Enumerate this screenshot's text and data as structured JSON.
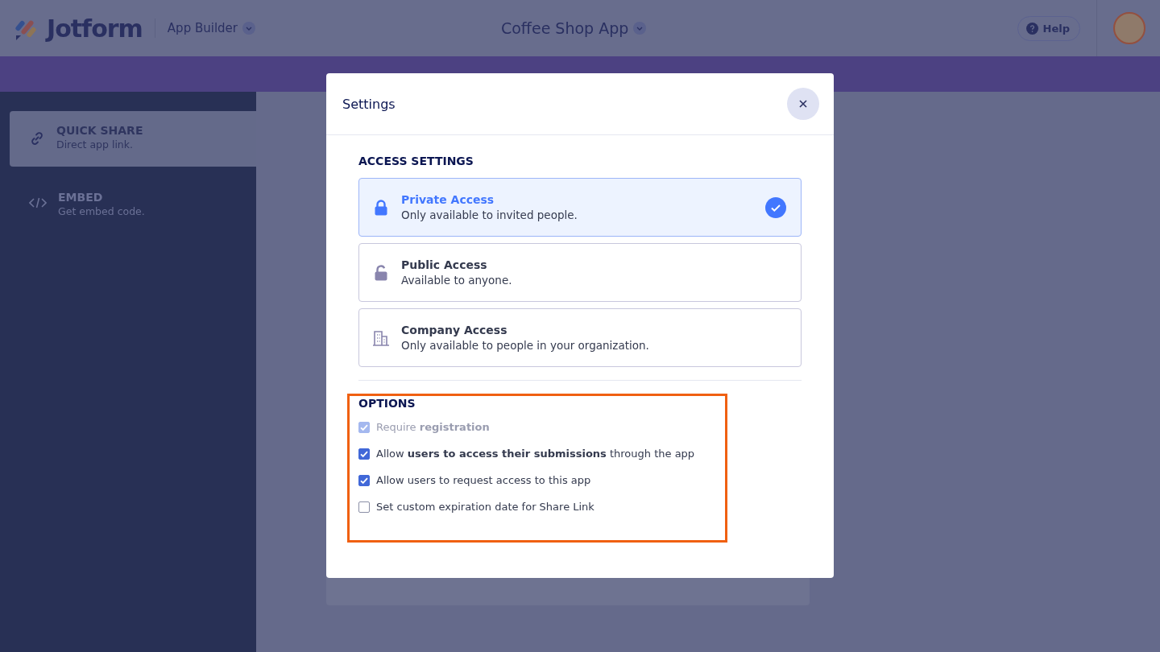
{
  "header": {
    "brand": "Jotform",
    "product": "App Builder",
    "app_title": "Coffee Shop App",
    "help": "Help"
  },
  "sidebar": {
    "items": [
      {
        "title": "QUICK SHARE",
        "subtitle": "Direct app link.",
        "selected": true,
        "kind": "link"
      },
      {
        "title": "EMBED",
        "subtitle": "Get embed code.",
        "selected": false,
        "kind": "code"
      }
    ]
  },
  "dialog": {
    "title": "Settings",
    "access_heading": "ACCESS SETTINGS",
    "access_options": [
      {
        "kind": "private",
        "title": "Private Access",
        "description": "Only available to invited people.",
        "selected": true
      },
      {
        "kind": "public",
        "title": "Public Access",
        "description": "Available to anyone.",
        "selected": false
      },
      {
        "kind": "company",
        "title": "Company Access",
        "description": "Only available to people in your organization.",
        "selected": false
      }
    ],
    "options_heading": "OPTIONS",
    "options": [
      {
        "label": "Require **registration**",
        "checked": true,
        "disabled": true
      },
      {
        "label": "Allow **users to access their submissions** through the app",
        "checked": true,
        "disabled": false
      },
      {
        "label": "Allow users to request access to this app",
        "checked": true,
        "disabled": false
      },
      {
        "label": "Set custom expiration date for Share Link",
        "checked": false,
        "disabled": false
      }
    ]
  }
}
